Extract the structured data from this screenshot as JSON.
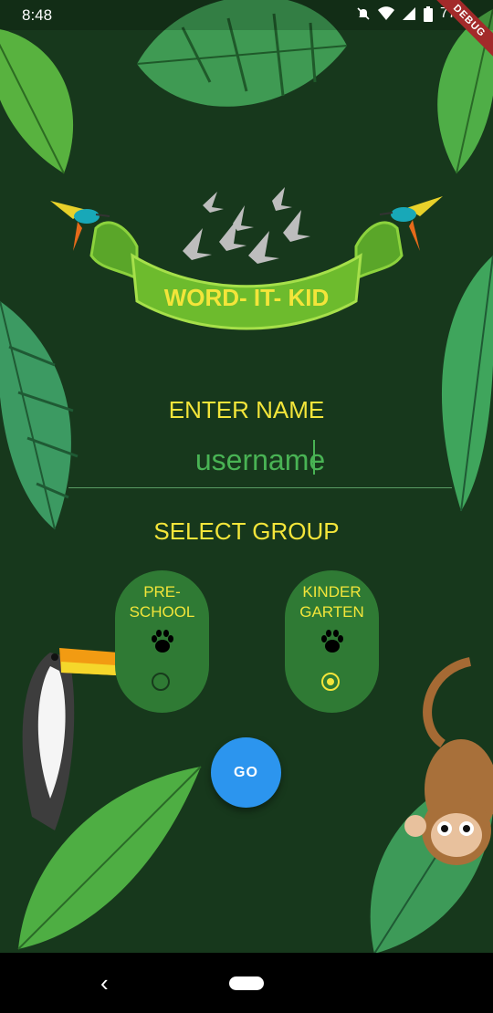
{
  "status_bar": {
    "time": "8:48",
    "battery": "77%",
    "icons": [
      "do-not-disturb-icon",
      "wifi-icon",
      "signal-icon",
      "battery-icon"
    ],
    "debug_banner": "DEBUG"
  },
  "logo": {
    "banner_text": "WORD- IT- KID"
  },
  "form": {
    "enter_name_label": "ENTER NAME",
    "username_value": "username",
    "select_group_label": "SELECT GROUP",
    "groups": [
      {
        "label_line1": "PRE-",
        "label_line2": "SCHOOL",
        "selected": false,
        "icon": "paw-icon"
      },
      {
        "label_line1": "KINDER",
        "label_line2": "GARTEN",
        "selected": true,
        "icon": "paw-icon"
      }
    ],
    "go_label": "GO"
  },
  "colors": {
    "background": "#17381c",
    "accent_yellow": "#f3e53a",
    "input_green": "#49b354",
    "card_green": "#2f7a34",
    "go_blue": "#2c95ee"
  },
  "nav_bar": {
    "icons": [
      "back-icon",
      "home-pill-icon"
    ]
  }
}
